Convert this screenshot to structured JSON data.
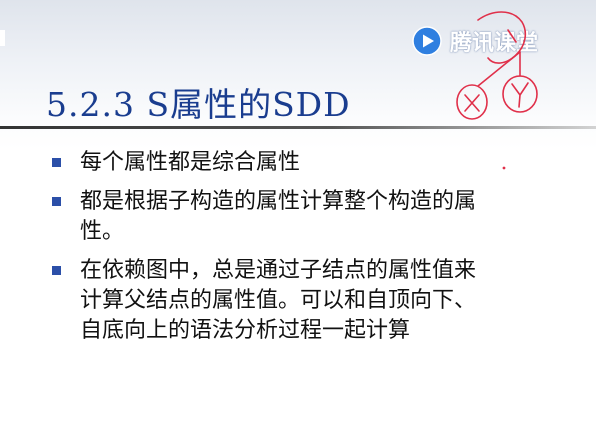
{
  "slide": {
    "title": "5.2.3 S属性的SDD",
    "watermark": {
      "text": "腾讯课堂",
      "icon": "tencent-classroom-play-icon"
    },
    "annotation": {
      "labels": [
        "X",
        "Y"
      ],
      "color": "#e0304a"
    },
    "accent_color": "#1a3d8f",
    "bullets": [
      {
        "lines": [
          "每个属性都是综合属性"
        ]
      },
      {
        "lines": [
          "都是根据子构造的属性计算整个构造的属",
          "性。"
        ]
      },
      {
        "lines": [
          "在依赖图中，总是通过子结点的属性值来",
          "计算父结点的属性值。可以和自顶向下、",
          "自底向上的语法分析过程一起计算"
        ]
      }
    ]
  }
}
